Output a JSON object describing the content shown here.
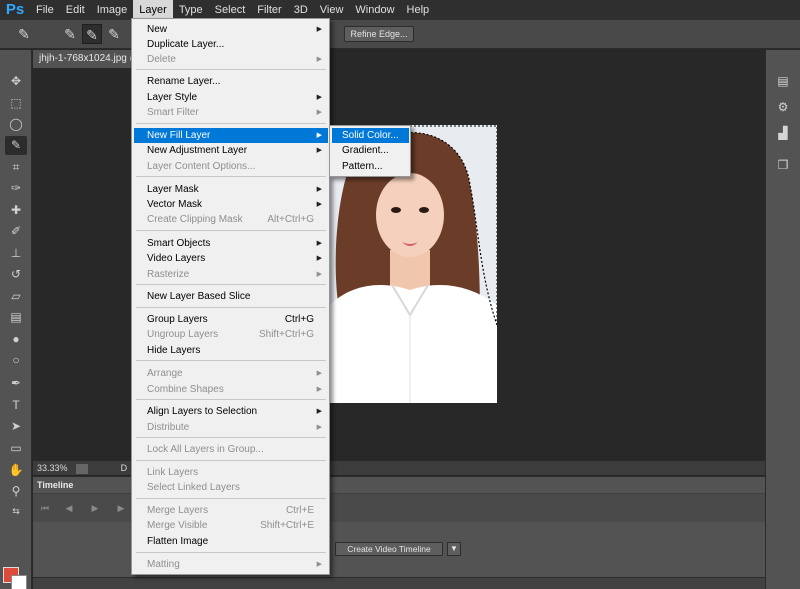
{
  "app": {
    "logo": "Ps"
  },
  "menubar": {
    "items": [
      "File",
      "Edit",
      "Image",
      "Layer",
      "Type",
      "Select",
      "Filter",
      "3D",
      "View",
      "Window",
      "Help"
    ],
    "active": "Layer"
  },
  "options": {
    "refine_edge_label": "Refine Edge..."
  },
  "document": {
    "tab_title": "jhjh-1-768x1024.jpg @",
    "zoom": "33.33%",
    "status_doc": "D"
  },
  "timeline": {
    "tab_label": "Timeline",
    "create_button_label": "Create Video Timeline"
  },
  "layer_menu": {
    "new": "New",
    "duplicate_layer": "Duplicate Layer...",
    "delete": "Delete",
    "rename_layer": "Rename Layer...",
    "layer_style": "Layer Style",
    "smart_filter": "Smart Filter",
    "new_fill_layer": "New Fill Layer",
    "new_adjustment_layer": "New Adjustment Layer",
    "layer_content_options": "Layer Content Options...",
    "layer_mask": "Layer Mask",
    "vector_mask": "Vector Mask",
    "create_clipping_mask": "Create Clipping Mask",
    "create_clipping_mask_shortcut": "Alt+Ctrl+G",
    "smart_objects": "Smart Objects",
    "video_layers": "Video Layers",
    "rasterize": "Rasterize",
    "new_layer_based_slice": "New Layer Based Slice",
    "group_layers": "Group Layers",
    "group_layers_shortcut": "Ctrl+G",
    "ungroup_layers": "Ungroup Layers",
    "ungroup_layers_shortcut": "Shift+Ctrl+G",
    "hide_layers": "Hide Layers",
    "arrange": "Arrange",
    "combine_shapes": "Combine Shapes",
    "align_layers_to_selection": "Align Layers to Selection",
    "distribute": "Distribute",
    "lock_all_layers_in_group": "Lock All Layers in Group...",
    "link_layers": "Link Layers",
    "select_linked_layers": "Select Linked Layers",
    "merge_layers": "Merge Layers",
    "merge_layers_shortcut": "Ctrl+E",
    "merge_visible": "Merge Visible",
    "merge_visible_shortcut": "Shift+Ctrl+E",
    "flatten_image": "Flatten Image",
    "matting": "Matting"
  },
  "fill_submenu": {
    "solid_color": "Solid Color...",
    "gradient": "Gradient...",
    "pattern": "Pattern..."
  },
  "colors": {
    "foreground": "#e04a3a",
    "background": "#ffffff",
    "highlight": "#0078d7",
    "logo": "#31a8ff"
  }
}
